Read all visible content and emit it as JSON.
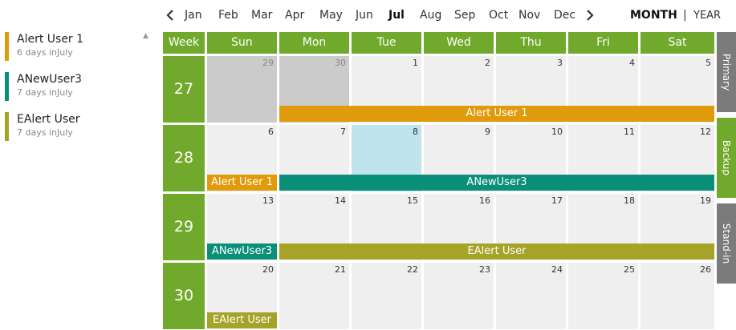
{
  "legend": [
    {
      "name": "Alert User 1",
      "sub": "6 days inJuly",
      "color": "#e09a0a"
    },
    {
      "name": "ANewUser3",
      "sub": "7 days inJuly",
      "color": "#0a8f79"
    },
    {
      "name": "EAlert User",
      "sub": "7 days inJuly",
      "color": "#a5a328"
    }
  ],
  "nav": {
    "prev_icon": "chevron-left-icon",
    "next_icon": "chevron-right-icon",
    "months": [
      "Jan",
      "Feb",
      "Mar",
      "Apr",
      "May",
      "Jun",
      "Jul",
      "Aug",
      "Sep",
      "Oct",
      "Nov",
      "Dec"
    ],
    "selected_month": "Jul",
    "view_month": "MONTH",
    "view_sep": "|",
    "view_year": "YEAR"
  },
  "calendar": {
    "week_header": "Week",
    "day_headers": [
      "Sun",
      "Mon",
      "Tue",
      "Wed",
      "Thu",
      "Fri",
      "Sat"
    ],
    "weeks": [
      {
        "number": "27",
        "days": [
          "29",
          "30",
          "1",
          "2",
          "3",
          "4",
          "5"
        ]
      },
      {
        "number": "28",
        "days": [
          "6",
          "7",
          "8",
          "9",
          "10",
          "11",
          "12"
        ]
      },
      {
        "number": "29",
        "days": [
          "13",
          "14",
          "15",
          "16",
          "17",
          "18",
          "19"
        ]
      },
      {
        "number": "30",
        "days": [
          "20",
          "21",
          "22",
          "23",
          "24",
          "25",
          "26"
        ]
      }
    ],
    "events": [
      {
        "label": "Alert User 1",
        "color": "#e09a0a"
      },
      {
        "label": "Alert User 1",
        "color": "#e09a0a"
      },
      {
        "label": "ANewUser3",
        "color": "#0a8f79"
      },
      {
        "label": "ANewUser3",
        "color": "#0a8f79"
      },
      {
        "label": "EAlert User",
        "color": "#a5a328"
      },
      {
        "label": "EAlert User",
        "color": "#a5a328"
      }
    ]
  },
  "side_tabs": [
    {
      "label": "Primary",
      "color": "#7b7b7b"
    },
    {
      "label": "Backup",
      "color": "#70a92b"
    },
    {
      "label": "Stand-in",
      "color": "#7b7b7b"
    }
  ],
  "colors": {
    "header_green": "#70a92b",
    "cell_bg": "#efefef",
    "other_month": "#cbcbcb",
    "today": "#bfe4ee"
  }
}
